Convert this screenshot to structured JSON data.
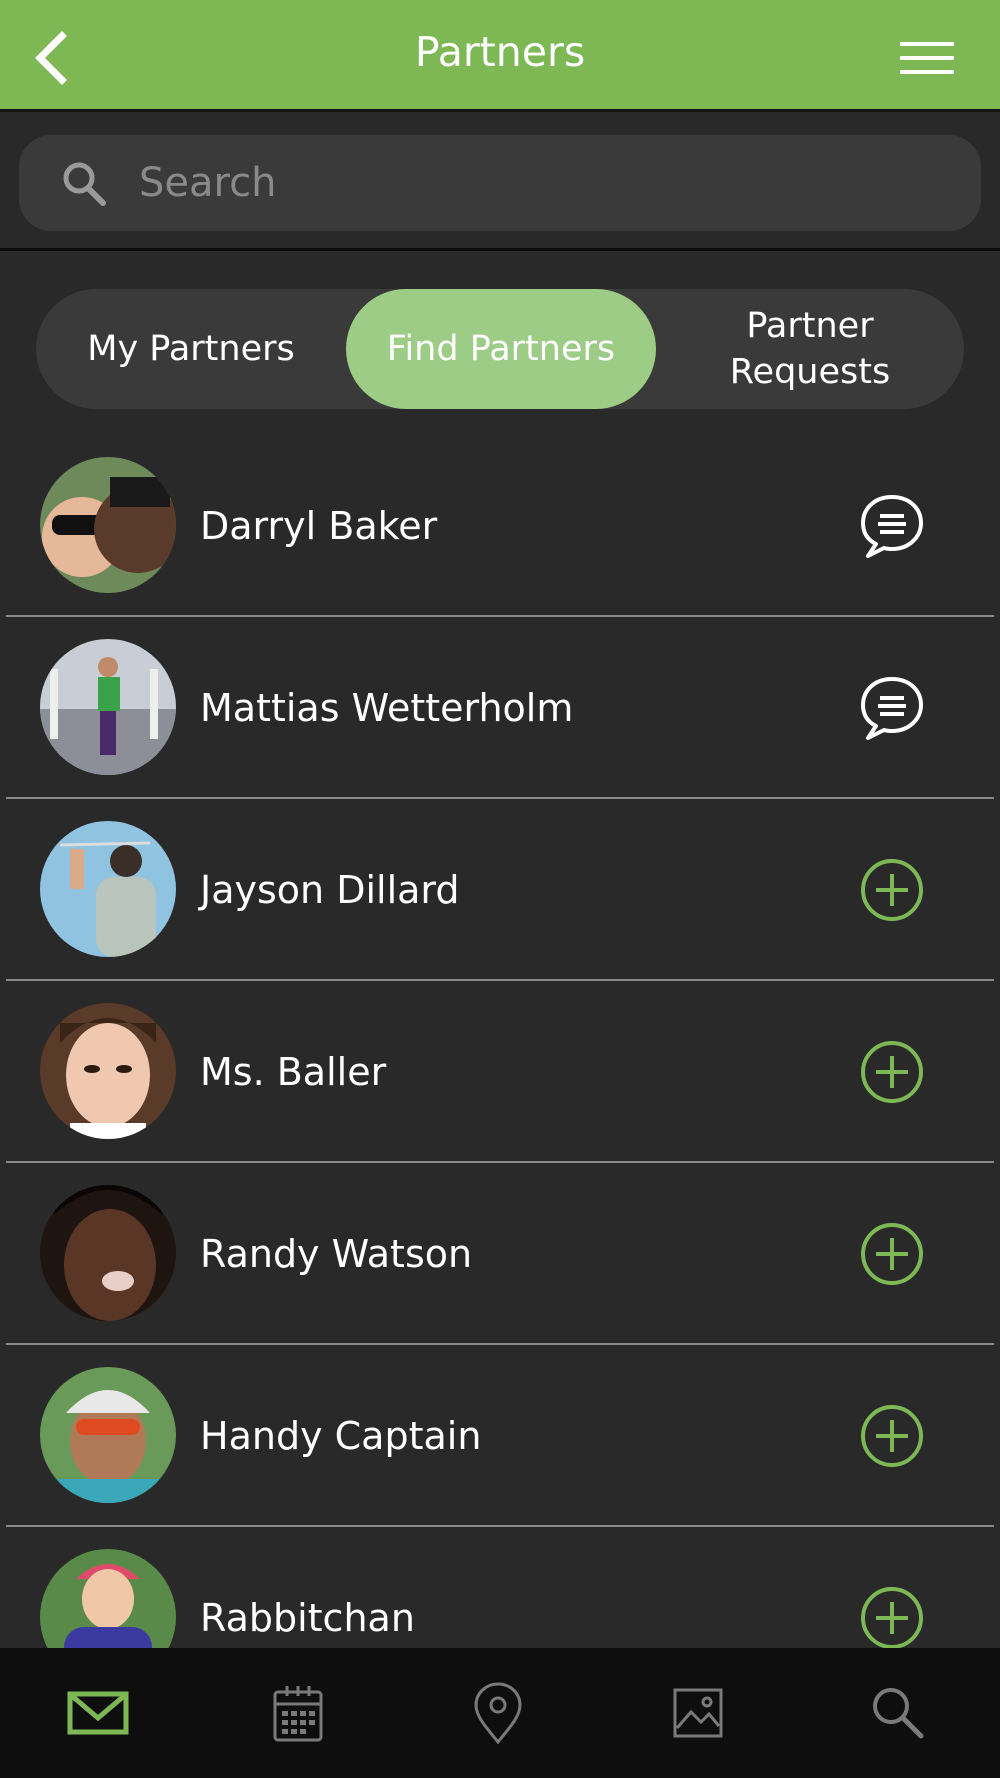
{
  "header": {
    "title": "Partners",
    "back_icon": "chevron-left-icon",
    "menu_icon": "hamburger-icon"
  },
  "search": {
    "placeholder": "Search",
    "icon": "search-icon"
  },
  "tabs": [
    {
      "label": "My Partners",
      "active": false
    },
    {
      "label": "Find Partners",
      "active": true
    },
    {
      "label": "Partner Requests",
      "active": false
    }
  ],
  "partners": [
    {
      "name": "Darryl Baker",
      "action": "message-icon"
    },
    {
      "name": "Mattias Wetterholm",
      "action": "message-icon"
    },
    {
      "name": "Jayson Dillard",
      "action": "add-icon"
    },
    {
      "name": "Ms. Baller",
      "action": "add-icon"
    },
    {
      "name": "Randy Watson",
      "action": "add-icon"
    },
    {
      "name": "Handy Captain",
      "action": "add-icon"
    },
    {
      "name": "Rabbitchan",
      "action": "add-icon"
    }
  ],
  "bottom_nav": [
    {
      "icon": "mail-icon",
      "active": true
    },
    {
      "icon": "calendar-icon",
      "active": false
    },
    {
      "icon": "location-pin-icon",
      "active": false
    },
    {
      "icon": "gallery-icon",
      "active": false
    },
    {
      "icon": "search-icon",
      "active": false
    }
  ],
  "colors": {
    "accent": "#7db855",
    "active_tab": "#9ccc85",
    "background": "#292929",
    "nav_background": "#0e0e0e"
  }
}
